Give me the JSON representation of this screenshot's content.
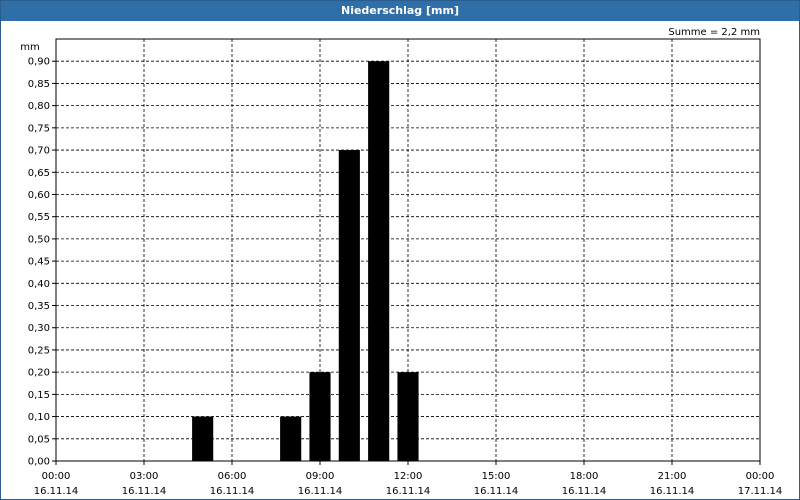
{
  "window": {
    "title": "Niederschlag [mm]"
  },
  "chart_data": {
    "type": "bar",
    "title": "Niederschlag [mm]",
    "ylabel": "mm",
    "annotation": "Summe = 2,2 mm",
    "ylim": [
      0,
      0.95
    ],
    "xlim_hours": [
      0,
      24
    ],
    "grid": true,
    "yticks": [
      "0,00",
      "0,05",
      "0,10",
      "0,15",
      "0,20",
      "0,25",
      "0,30",
      "0,35",
      "0,40",
      "0,45",
      "0,50",
      "0,55",
      "0,60",
      "0,65",
      "0,70",
      "0,75",
      "0,80",
      "0,85",
      "0,90"
    ],
    "xticks": [
      {
        "time": "00:00",
        "date": "16.11.14"
      },
      {
        "time": "03:00",
        "date": "16.11.14"
      },
      {
        "time": "06:00",
        "date": "16.11.14"
      },
      {
        "time": "09:00",
        "date": "16.11.14"
      },
      {
        "time": "12:00",
        "date": "16.11.14"
      },
      {
        "time": "15:00",
        "date": "16.11.14"
      },
      {
        "time": "18:00",
        "date": "16.11.14"
      },
      {
        "time": "21:00",
        "date": "16.11.14"
      },
      {
        "time": "00:00",
        "date": "17.11.14"
      }
    ],
    "bars": [
      {
        "time": "05:00",
        "value": 0.1
      },
      {
        "time": "08:00",
        "value": 0.1
      },
      {
        "time": "09:00",
        "value": 0.2
      },
      {
        "time": "10:00",
        "value": 0.7
      },
      {
        "time": "11:00",
        "value": 0.9
      },
      {
        "time": "12:00",
        "value": 0.2
      }
    ],
    "colors": {
      "bar": "#000000",
      "title_bar": "#2f6ea6",
      "grid": "#000000"
    }
  }
}
